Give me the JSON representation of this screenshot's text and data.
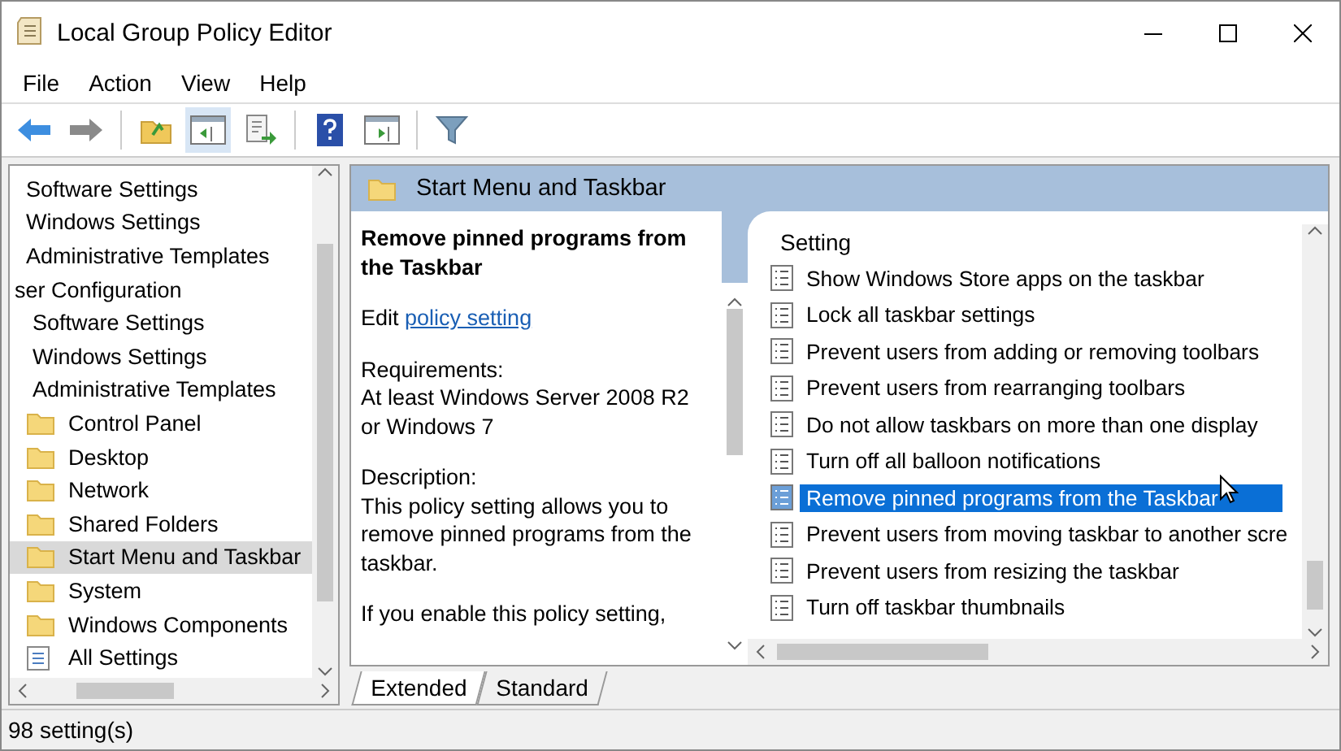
{
  "window": {
    "title": "Local Group Policy Editor"
  },
  "menu": [
    "File",
    "Action",
    "View",
    "Help"
  ],
  "tree": [
    {
      "children": [
        {
          "label": "Software Settings",
          "selected": false
        },
        {
          "label": "Windows Settings",
          "selected": false
        },
        {
          "label": "Administrative Templates",
          "selected": false
        }
      ]
    },
    {
      "label": "ser Configuration",
      "selected": false,
      "children": [
        {
          "label": "Software Settings",
          "selected": false
        },
        {
          "label": "Windows Settings",
          "selected": false
        },
        {
          "label": "Administrative Templates",
          "selected": false,
          "children": [
            {
              "label": "Control Panel",
              "kind": "folder",
              "selected": false
            },
            {
              "label": "Desktop",
              "kind": "folder",
              "selected": false
            },
            {
              "label": "Network",
              "kind": "folder",
              "selected": false
            },
            {
              "label": "Shared Folders",
              "kind": "folder",
              "selected": false
            },
            {
              "label": "Start Menu and Taskbar",
              "kind": "folder",
              "selected": true
            },
            {
              "label": "System",
              "kind": "folder",
              "selected": false
            },
            {
              "label": "Windows Components",
              "kind": "folder",
              "selected": false
            },
            {
              "label": "All Settings",
              "kind": "settings",
              "selected": false
            }
          ]
        }
      ]
    }
  ],
  "header": {
    "title": "Start Menu and Taskbar"
  },
  "details": {
    "title": "Remove pinned programs from the Taskbar",
    "edit_prefix": "Edit",
    "edit_link": "policy setting",
    "requirements_label": "Requirements:",
    "requirements": "At least Windows Server 2008 R2 or Windows 7",
    "description_label": "Description:",
    "description": "This policy setting allows you to remove pinned programs from the taskbar.",
    "more": "If you enable this policy setting,"
  },
  "list": {
    "column": "Setting",
    "items": [
      {
        "label": "Show Windows Store apps on the taskbar",
        "selected": false
      },
      {
        "label": "Lock all taskbar settings",
        "selected": false
      },
      {
        "label": "Prevent users from adding or removing toolbars",
        "selected": false
      },
      {
        "label": "Prevent users from rearranging toolbars",
        "selected": false
      },
      {
        "label": "Do not allow taskbars on more than one display",
        "selected": false
      },
      {
        "label": "Turn off all balloon notifications",
        "selected": false
      },
      {
        "label": "Remove pinned programs from the Taskbar",
        "selected": true
      },
      {
        "label": "Prevent users from moving taskbar to another scre",
        "selected": false
      },
      {
        "label": "Prevent users from resizing the taskbar",
        "selected": false
      },
      {
        "label": "Turn off taskbar thumbnails",
        "selected": false
      }
    ]
  },
  "tabs": [
    {
      "label": "Extended",
      "selected": true
    },
    {
      "label": "Standard",
      "selected": false
    }
  ],
  "status_bar": "98 setting(s)"
}
